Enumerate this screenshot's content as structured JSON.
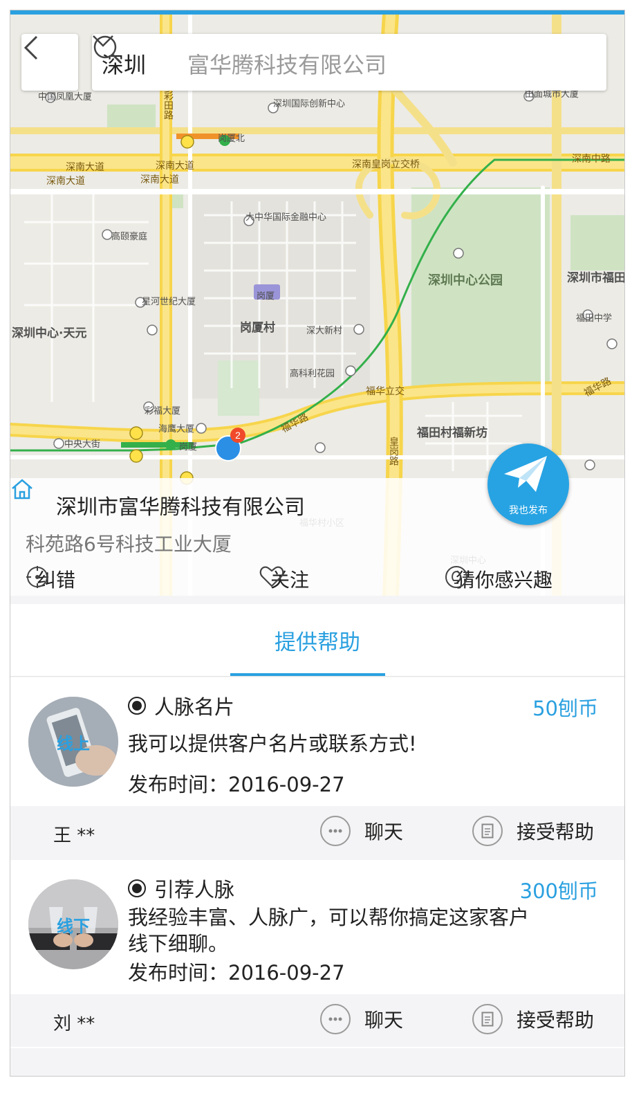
{
  "search": {
    "city": "深圳",
    "query": "富华腾科技有限公司"
  },
  "map": {
    "labels": [
      {
        "text": "中国凤凰大厦",
        "cls": ""
      },
      {
        "text": "深圳国际创新中心",
        "cls": ""
      },
      {
        "text": "岗厦北",
        "cls": ""
      },
      {
        "text": "田面城市大厦",
        "cls": ""
      },
      {
        "text": "深南大道",
        "cls": "road"
      },
      {
        "text": "深南大道",
        "cls": "road"
      },
      {
        "text": "深南大道",
        "cls": "road"
      },
      {
        "text": "深南大道",
        "cls": "road"
      },
      {
        "text": "深南皇岗立交桥",
        "cls": "road"
      },
      {
        "text": "深南中路",
        "cls": "road"
      },
      {
        "text": "大中华国际金融中心",
        "cls": ""
      },
      {
        "text": "高颐豪庭",
        "cls": ""
      },
      {
        "text": "深圳中心公园",
        "cls": "park"
      },
      {
        "text": "深圳市福田",
        "cls": "big"
      },
      {
        "text": "星河世纪大厦",
        "cls": ""
      },
      {
        "text": "岗厦",
        "cls": ""
      },
      {
        "text": "岗厦村",
        "cls": "big"
      },
      {
        "text": "深圳中心·天元",
        "cls": "big"
      },
      {
        "text": "深大新村",
        "cls": ""
      },
      {
        "text": "福田中学",
        "cls": ""
      },
      {
        "text": "高科利花园",
        "cls": ""
      },
      {
        "text": "福华立交",
        "cls": "road"
      },
      {
        "text": "福田村福新坊",
        "cls": "big"
      },
      {
        "text": "彩福大厦",
        "cls": ""
      },
      {
        "text": "海鹰大厦",
        "cls": ""
      },
      {
        "text": "中央大街",
        "cls": ""
      },
      {
        "text": "岗厦",
        "cls": ""
      },
      {
        "text": "福华路",
        "cls": "road"
      },
      {
        "text": "福华村小区",
        "cls": ""
      },
      {
        "text": "深圳中心",
        "cls": ""
      },
      {
        "text": "彩田路",
        "cls": "road"
      },
      {
        "text": "皇岗路",
        "cls": "road"
      },
      {
        "text": "福华路",
        "cls": "road"
      }
    ],
    "marker_count": "2",
    "fab_label": "我也发布"
  },
  "place": {
    "name": "深圳市富华腾科技有限公司",
    "address": "科苑路6号科技工业大厦",
    "actions": [
      "纠错",
      "关注",
      "猜你感兴趣"
    ]
  },
  "tab": {
    "label": "提供帮助"
  },
  "posts": [
    {
      "avatar_text": "线上",
      "title": "人脉名片",
      "price": "50刨币",
      "desc_lines": [
        "我可以提供客户名片或联系方式!"
      ],
      "time": "发布时间：2016-09-27",
      "user": "王 **",
      "chat_label": "聊天",
      "accept_label": "接受帮助"
    },
    {
      "avatar_text": "线下",
      "title": "引荐人脉",
      "price": "300刨币",
      "desc_lines": [
        "我经验丰富、人脉广，可以帮你搞定这家客户",
        "线下细聊。"
      ],
      "time": "发布时间：2016-09-27",
      "user": "刘 **",
      "chat_label": "聊天",
      "accept_label": "接受帮助"
    }
  ]
}
